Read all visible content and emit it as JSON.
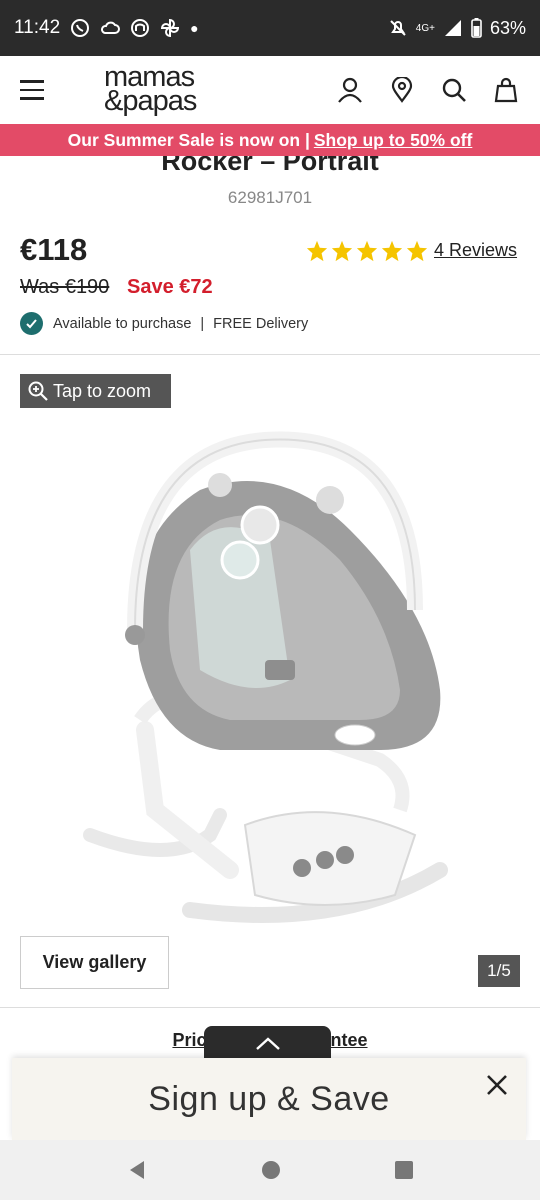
{
  "status_bar": {
    "time": "11:42",
    "network": "4G+",
    "battery": "63%"
  },
  "header": {
    "logo_line1": "mamas",
    "logo_line2": "&papas",
    "icons": [
      "menu-icon",
      "account-icon",
      "location-icon",
      "search-icon",
      "bag-icon"
    ]
  },
  "promo": {
    "text": "Our Summer Sale is now on |",
    "link": "Shop up to 50% off"
  },
  "product": {
    "title": "Rocker – Portrait",
    "sku": "62981J701",
    "price": "€118",
    "was_price": "Was €190",
    "save": "Save €72",
    "rating": 5,
    "reviews": "4 Reviews",
    "availability": "Available to purchase",
    "delivery": "FREE Delivery"
  },
  "gallery": {
    "zoom_label": "Tap to zoom",
    "view_gallery": "View gallery",
    "counter": "1/5"
  },
  "guarantee": {
    "text": "Price Match Guarantee"
  },
  "signup": {
    "label": "Sign up & Save"
  },
  "colors": {
    "promo_bg": "#e34b67",
    "save_red": "#d31e2c",
    "check_teal": "#1e6e6e",
    "star_yellow": "#f5c400"
  }
}
